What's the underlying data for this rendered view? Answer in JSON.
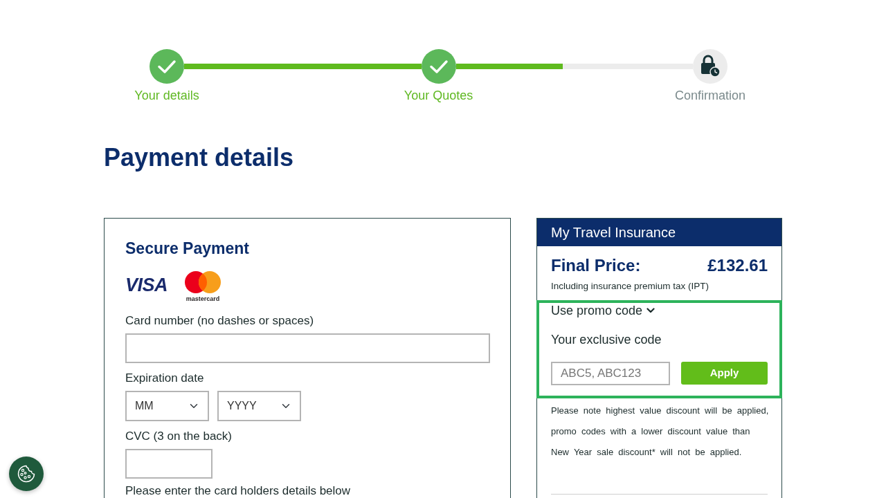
{
  "progress": {
    "level": 0.45,
    "steps": [
      {
        "label": "Your details",
        "completed": true
      },
      {
        "label": "Your Quotes",
        "completed": true
      },
      {
        "label": "Confirmation",
        "completed": false
      }
    ]
  },
  "page_title": "Payment details",
  "secure_payment": {
    "title": "Secure Payment",
    "card_logos": [
      {
        "kind": "visa",
        "text": "VISA"
      },
      {
        "kind": "mastercard",
        "text": "mastercard"
      }
    ],
    "fields": [
      {
        "kind": "text",
        "label": "Card number (no dashes or spaces)"
      },
      {
        "kind": "selects",
        "label": "Expiration date",
        "selects": [
          {
            "value": "MM"
          },
          {
            "value": "YYYY"
          }
        ]
      },
      {
        "kind": "short-text",
        "label": "CVC (3 on the back)"
      }
    ],
    "note": "Please enter the card holders details below"
  },
  "summary": {
    "title": "My Travel Insurance",
    "price_label": "Final Price:",
    "price": "£132.61",
    "tax_note": "Including insurance premium tax (IPT)",
    "promo": {
      "toggle": "Use promo code",
      "expanded": true,
      "field_label": "Your exclusive code",
      "placeholder": "ABC5, ABC123",
      "button": "Apply"
    },
    "disclaimer": "Please note highest value discount will be applied, promo codes with a lower discount value than New Year sale discount* will not be applied."
  }
}
